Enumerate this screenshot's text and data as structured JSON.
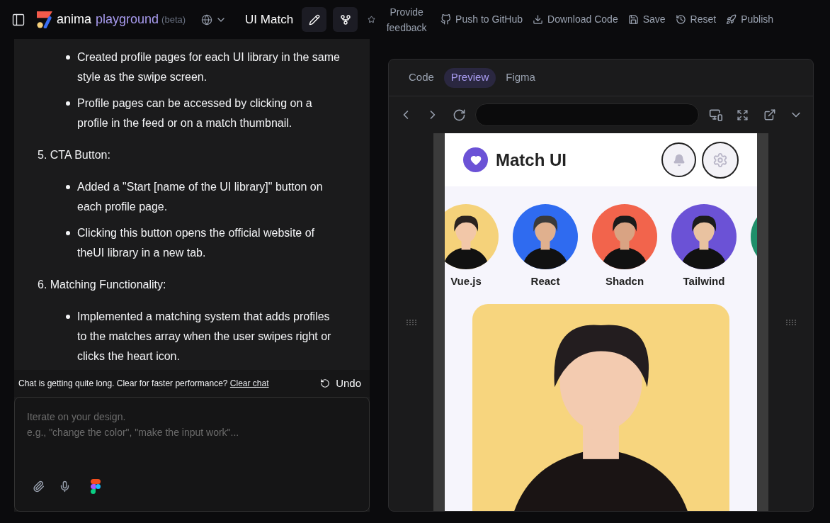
{
  "topbar": {
    "brand": "anima",
    "product": "playground",
    "tag": "(beta)",
    "project": "UI Match",
    "feedback": "Provide feedback",
    "actions": [
      {
        "label": "Push to GitHub"
      },
      {
        "label": "Download Code"
      },
      {
        "label": "Save"
      },
      {
        "label": "Reset"
      },
      {
        "label": "Publish"
      }
    ]
  },
  "chat": {
    "items": [
      {
        "kind": "bullet",
        "text": "Created profile pages for each UI library in the same style as the swipe screen."
      },
      {
        "kind": "bullet",
        "text": "Profile pages can be accessed by clicking on a profile in the feed or on a match thumbnail."
      },
      {
        "kind": "heading",
        "text": "5. CTA Button:"
      },
      {
        "kind": "bullet",
        "text": "Added a \"Start [name of the UI library]\" button on each profile page."
      },
      {
        "kind": "bullet",
        "text": "Clicking this button opens the official website of theUI library in a new tab."
      },
      {
        "kind": "heading",
        "text": "6. Matching Functionality:"
      },
      {
        "kind": "bullet",
        "text": "Implemented a matching system that adds profiles to the matches array when the user swipes right or clicks the heart icon."
      }
    ],
    "notice": "Chat is getting quite long. Clear for faster performance?",
    "notice_link": "Clear chat",
    "undo": "Undo",
    "input": {
      "placeholder": "Iterate on your design.\ne.g., \"change the color\", \"make the input work\"..."
    }
  },
  "preview": {
    "tabs": [
      {
        "label": "Code",
        "selected": false
      },
      {
        "label": "Preview",
        "selected": true
      },
      {
        "label": "Figma",
        "selected": false
      }
    ],
    "app": {
      "title": "Match UI",
      "profiles": [
        {
          "name": "Vue.js"
        },
        {
          "name": "React"
        },
        {
          "name": "Shadcn"
        },
        {
          "name": "Tailwind"
        }
      ]
    }
  }
}
